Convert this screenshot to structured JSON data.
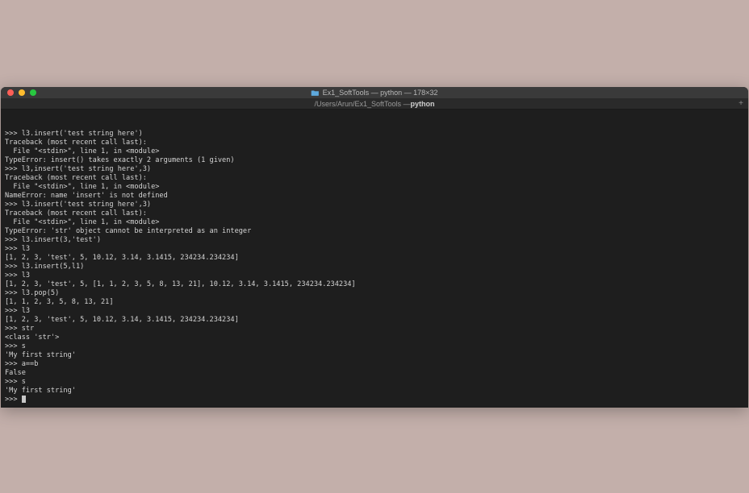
{
  "window": {
    "title": "Ex1_SoftTools — python — 178×32",
    "tab_path": "/Users/Arun/Ex1_SoftTools — ",
    "tab_process": "python"
  },
  "terminal": {
    "lines": [
      ">>> l3.insert('test string here')",
      "Traceback (most recent call last):",
      "  File \"<stdin>\", line 1, in <module>",
      "TypeError: insert() takes exactly 2 arguments (1 given)",
      ">>> l3,insert('test string here',3)",
      "Traceback (most recent call last):",
      "  File \"<stdin>\", line 1, in <module>",
      "NameError: name 'insert' is not defined",
      ">>> l3.insert('test string here',3)",
      "Traceback (most recent call last):",
      "  File \"<stdin>\", line 1, in <module>",
      "TypeError: 'str' object cannot be interpreted as an integer",
      ">>> l3.insert(3,'test')",
      ">>> l3",
      "[1, 2, 3, 'test', 5, 10.12, 3.14, 3.1415, 234234.234234]",
      ">>> l3.insert(5,l1)",
      ">>> l3",
      "[1, 2, 3, 'test', 5, [1, 1, 2, 3, 5, 8, 13, 21], 10.12, 3.14, 3.1415, 234234.234234]",
      ">>> l3.pop(5)",
      "[1, 1, 2, 3, 5, 8, 13, 21]",
      ">>> l3",
      "[1, 2, 3, 'test', 5, 10.12, 3.14, 3.1415, 234234.234234]",
      ">>> str",
      "<class 'str'>",
      ">>> s",
      "'My first string'",
      ">>> a==b",
      "False",
      ">>> s",
      "'My first string'",
      ">>> "
    ]
  }
}
